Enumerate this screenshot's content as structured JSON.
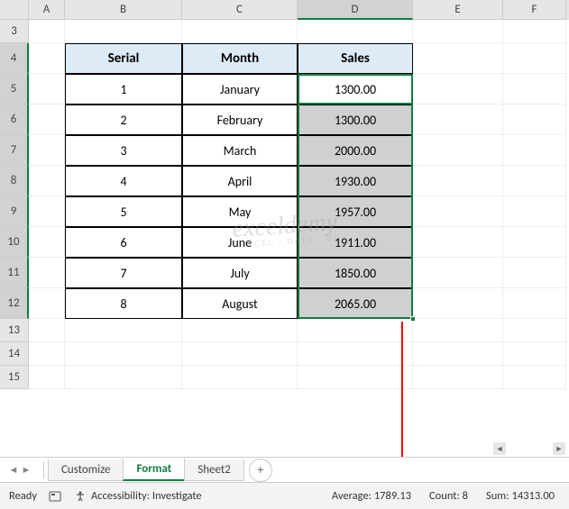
{
  "columns": [
    "A",
    "B",
    "C",
    "D",
    "E",
    "F"
  ],
  "visible_rows": [
    "3",
    "4",
    "5",
    "6",
    "7",
    "8",
    "9",
    "10",
    "11",
    "12",
    "13",
    "14",
    "15"
  ],
  "active_column": "D",
  "table": {
    "headers": {
      "serial": "Serial",
      "month": "Month",
      "sales": "Sales"
    },
    "rows": [
      {
        "serial": "1",
        "month": "January",
        "sales": "1300.00"
      },
      {
        "serial": "2",
        "month": "February",
        "sales": "1300.00"
      },
      {
        "serial": "3",
        "month": "March",
        "sales": "2000.00"
      },
      {
        "serial": "4",
        "month": "April",
        "sales": "1930.00"
      },
      {
        "serial": "5",
        "month": "May",
        "sales": "1957.00"
      },
      {
        "serial": "6",
        "month": "June",
        "sales": "1911.00"
      },
      {
        "serial": "7",
        "month": "July",
        "sales": "1850.00"
      },
      {
        "serial": "8",
        "month": "August",
        "sales": "2065.00"
      }
    ]
  },
  "tabs": {
    "list": [
      {
        "label": "Customize",
        "active": false
      },
      {
        "label": "Format",
        "active": true
      },
      {
        "label": "Sheet2",
        "active": false
      }
    ]
  },
  "status": {
    "ready": "Ready",
    "accessibility": "Accessibility: Investigate",
    "average_label": "Average:",
    "average_value": "1789.13",
    "count_label": "Count:",
    "count_value": "8",
    "sum_label": "Sum:",
    "sum_value": "14313.00"
  },
  "watermark": {
    "main": "exceldemy",
    "sub": "EXCEL · DATA · BI"
  },
  "chart_data": {
    "type": "table",
    "categories": [
      "January",
      "February",
      "March",
      "April",
      "May",
      "June",
      "July",
      "August"
    ],
    "values": [
      1300.0,
      1300.0,
      2000.0,
      1930.0,
      1957.0,
      1911.0,
      1850.0,
      2065.0
    ],
    "title": "Sales",
    "xlabel": "Month",
    "ylabel": "Sales",
    "aggregate": {
      "average": 1789.13,
      "count": 8,
      "sum": 14313.0
    }
  }
}
